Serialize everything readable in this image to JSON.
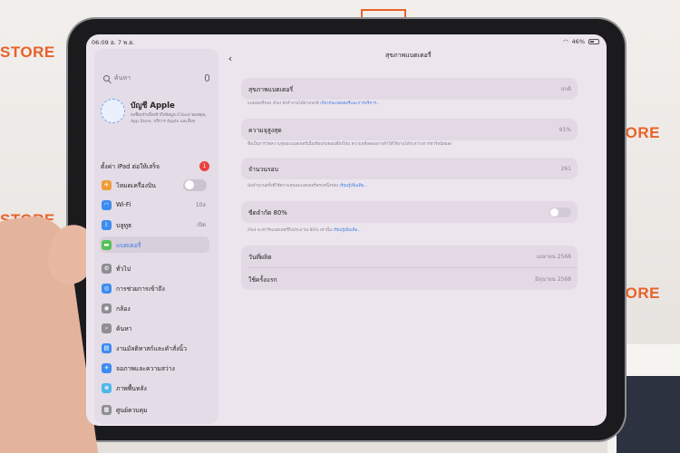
{
  "watermark": {
    "brand": "STORE",
    "brand_left": "STORE"
  },
  "status_bar": {
    "time": "06:09",
    "date": "อ. 7 พ.ย.",
    "battery": "46%"
  },
  "sidebar": {
    "search_placeholder": "ค้นหา",
    "account": {
      "title": "บัญชี Apple",
      "subtitle": "ลงชื่อเข้าเพื่อเข้าถึงข้อมูล iCloud ของคุณ, App Store, บริการ Apple และอื่นๆ"
    },
    "setup_label": "ตั้งค่า iPad ต่อให้เสร็จ",
    "setup_badge": "1",
    "items": [
      {
        "label": "โหมดเครื่องบิน",
        "value": "",
        "icon": "airplane-icon",
        "color": "#f19a38"
      },
      {
        "label": "Wi-Fi",
        "value": "10x",
        "icon": "wifi-icon",
        "color": "#3d8bf0"
      },
      {
        "label": "บลูทูธ",
        "value": "เปิด",
        "icon": "bluetooth-icon",
        "color": "#3d8bf0"
      },
      {
        "label": "แบตเตอรี่",
        "value": "",
        "icon": "battery-icon",
        "color": "#55c258"
      },
      {
        "label": "ทั่วไป",
        "value": "",
        "icon": "gear-icon",
        "color": "#8e8e93"
      },
      {
        "label": "การช่วยการเข้าถึง",
        "value": "",
        "icon": "accessibility-icon",
        "color": "#3d8bf0"
      },
      {
        "label": "กล้อง",
        "value": "",
        "icon": "camera-icon",
        "color": "#8e8e93"
      },
      {
        "label": "ค้นหา",
        "value": "",
        "icon": "search-icon",
        "color": "#8e8e93"
      },
      {
        "label": "งานมัลติทาสก์และคำสั่งนิ้ว",
        "value": "",
        "icon": "multitasking-icon",
        "color": "#3d8bf0"
      },
      {
        "label": "จอภาพและความสว่าง",
        "value": "",
        "icon": "brightness-icon",
        "color": "#3d8bf0"
      },
      {
        "label": "ภาพพื้นหลัง",
        "value": "",
        "icon": "wallpaper-icon",
        "color": "#4fb6ec"
      },
      {
        "label": "ศูนย์ควบคุม",
        "value": "",
        "icon": "control-center-icon",
        "color": "#8e8e93"
      }
    ]
  },
  "panel": {
    "title": "สุขภาพแบตเตอรี่",
    "rows": {
      "health": {
        "label": "สุขภาพแบตเตอรี่",
        "value": "ปกติ"
      },
      "health_caption": "แบตเตอรี่ของ iPad ยังทำงานได้ตามปกติ",
      "health_caption_link": "เกี่ยวกับแบตเตอรี่และการบริการ...",
      "max_capacity": {
        "label": "ความจุสูงสุด",
        "value": "91%"
      },
      "max_capacity_caption": "ซึ่งเป็นการวัดความจุของแบตเตอรี่เมื่อเทียบกับตอนที่ยังใหม่ ความจุที่ลดลงอาจทำให้ใช้งานได้ระหว่างการชาร์จน้อยลง",
      "cycles": {
        "label": "จำนวนรอบ",
        "value": "261"
      },
      "cycles_caption": "นับจำนวนครั้งที่ใช้ความจุของแบตเตอรี่ครบหนึ่งรอบ",
      "cycles_caption_link": "เรียนรู้เพิ่มเติม...",
      "limit": {
        "label": "ขีดจำกัด 80%"
      },
      "limit_caption": "iPad จะชาร์จแบตเตอรี่ถึงประมาณ 80% เท่านั้น",
      "limit_caption_link": "เรียนรู้เพิ่มเติม...",
      "manufacture": {
        "label": "วันที่ผลิต",
        "value": "เมษายน 2568"
      },
      "first_use": {
        "label": "ใช้ครั้งแรก",
        "value": "มิถุนายน 2568"
      }
    }
  }
}
